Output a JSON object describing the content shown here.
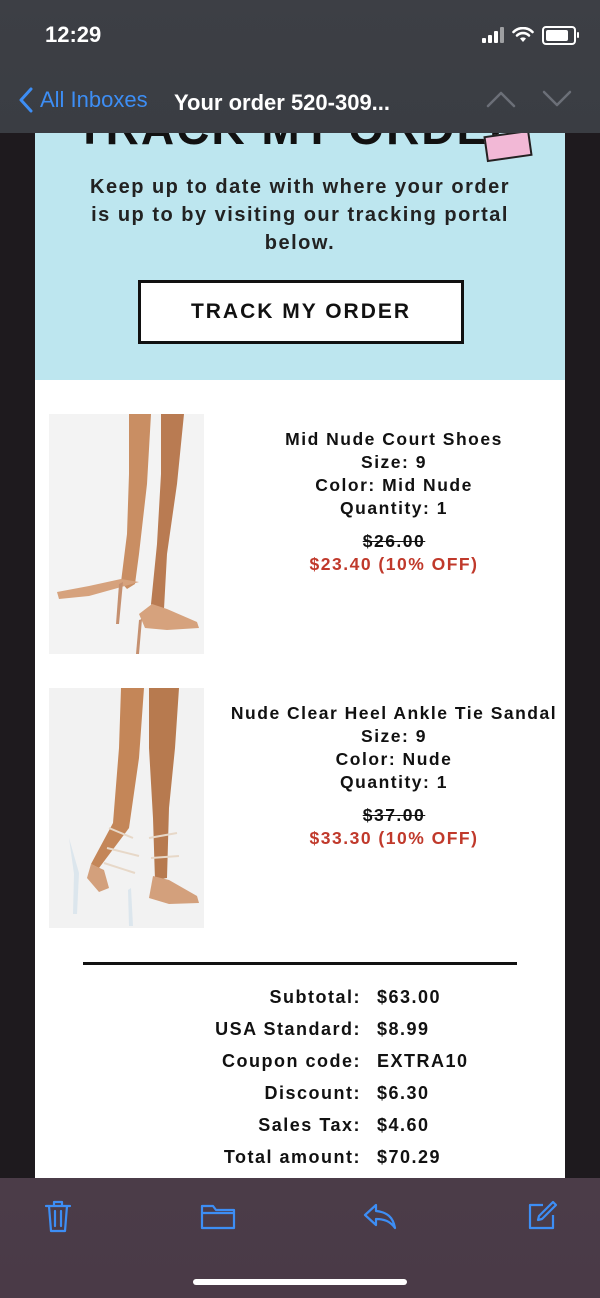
{
  "status_bar": {
    "time": "12:29"
  },
  "nav": {
    "back_label": "All Inboxes",
    "subject": "Your order 520-309..."
  },
  "hero": {
    "heading": "TRACK MY ORDER",
    "description": "Keep up to date with where your order is up to by visiting our tracking portal below.",
    "button_label": "TRACK MY ORDER"
  },
  "products": [
    {
      "name": "Mid Nude Court Shoes",
      "size": "Size: 9",
      "color": "Color: Mid Nude",
      "quantity": "Quantity: 1",
      "old_price": "$26.00",
      "new_price": "$23.40 (10% OFF)"
    },
    {
      "name": "Nude Clear Heel Ankle Tie Sandal",
      "size": "Size: 9",
      "color": "Color: Nude",
      "quantity": "Quantity: 1",
      "old_price": "$37.00",
      "new_price": "$33.30 (10% OFF)"
    }
  ],
  "summary": [
    {
      "label": "Subtotal:",
      "value": "$63.00"
    },
    {
      "label": "USA Standard:",
      "value": "$8.99"
    },
    {
      "label": "Coupon code:",
      "value": "EXTRA10"
    },
    {
      "label": "Discount:",
      "value": "$6.30"
    },
    {
      "label": "Sales Tax:",
      "value": "$4.60"
    },
    {
      "label": "Total amount:",
      "value": "$70.29"
    }
  ],
  "colors": {
    "accent": "#3d8ef5",
    "hero_bg": "#bde6ef",
    "sale_red": "#c0392b"
  },
  "icons": [
    "chevron-left-icon",
    "chevron-up-icon",
    "chevron-down-icon",
    "trash-icon",
    "folder-icon",
    "reply-icon",
    "compose-icon"
  ]
}
